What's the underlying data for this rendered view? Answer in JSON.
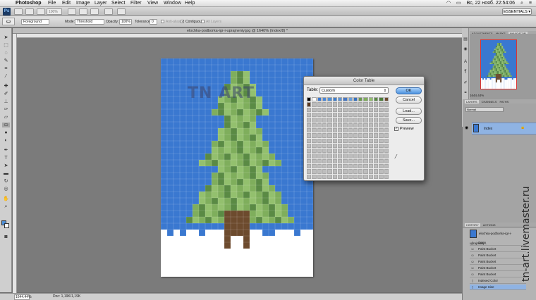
{
  "menubar": {
    "app": "Photoshop",
    "items": [
      "File",
      "Edit",
      "Image",
      "Layer",
      "Select",
      "Filter",
      "View",
      "Window",
      "Help"
    ],
    "clock": "Вс, 22 нояб.  22:54:06"
  },
  "appbar": {
    "zoom": "100%",
    "workspace": "ESSENTIALS ▾"
  },
  "options": {
    "fill_source": "Foreground",
    "mode_label": "Mode:",
    "mode_value": "Threshold",
    "opacity_label": "Opacity:",
    "opacity_value": "100%",
    "tolerance_label": "Tolerance:",
    "tolerance_value": "0",
    "antialias_label": "Anti-alias",
    "contiguous_label": "Contiguous",
    "all_layers_label": "All Layers"
  },
  "document": {
    "tab_title": "elochka-podborka-igr-i-uprajneniy.jpg @ 1640% (Index/8) *",
    "watermark": "TN ART",
    "status_zoom": "1644.44%",
    "status_doc": "Doc: 1,19K/1,19K"
  },
  "dialog": {
    "title": "Color Table",
    "table_label": "Table:",
    "table_value": "Custom",
    "ok_label": "OK",
    "cancel_label": "Cancel",
    "load_label": "Load...",
    "save_label": "Save...",
    "preview_label": "Preview",
    "preview_checked": true,
    "swatches": [
      "#000000",
      "#ffffff",
      "#3a78d0",
      "#4a86d8",
      "#4f90d8",
      "#3d7ecf",
      "#5b95da",
      "#4677c4",
      "#6a9fd9",
      "#3570c0",
      "#6b9b4e",
      "#7fae5c",
      "#93c06e",
      "#5a8a44",
      "#4e7d3a",
      "#6d4b2e",
      "#5a3a22"
    ]
  },
  "panels": {
    "top_tabs": [
      "ADJUSTMENTS",
      "MASKS",
      "NAVIGATOR"
    ],
    "navigator_zoom": "1644.44%",
    "layer_tabs": [
      "LAYERS",
      "CHANNELS",
      "PATHS"
    ],
    "layer_mode": "Normal",
    "layer_name": "Index",
    "history_tabs": [
      "HISTORY",
      "ACTIONS"
    ],
    "history_snapshot": "elochka-podborka-igr-i-uprajneniy...",
    "history_items": [
      "Open",
      "Paint Bucket",
      "Paint Bucket",
      "Paint Bucket",
      "Paint Bucket",
      "Paint Bucket",
      "Indexed Color",
      "Image Size"
    ]
  },
  "watermark_site": "tn-art.livemaster.ru",
  "colors": {
    "sky": "#3a78d0",
    "tree_light": "#93c06e",
    "tree_mid": "#7fae5c",
    "tree_dark": "#5a8a44",
    "trunk": "#6d4b2e",
    "snow": "#ffffff"
  }
}
